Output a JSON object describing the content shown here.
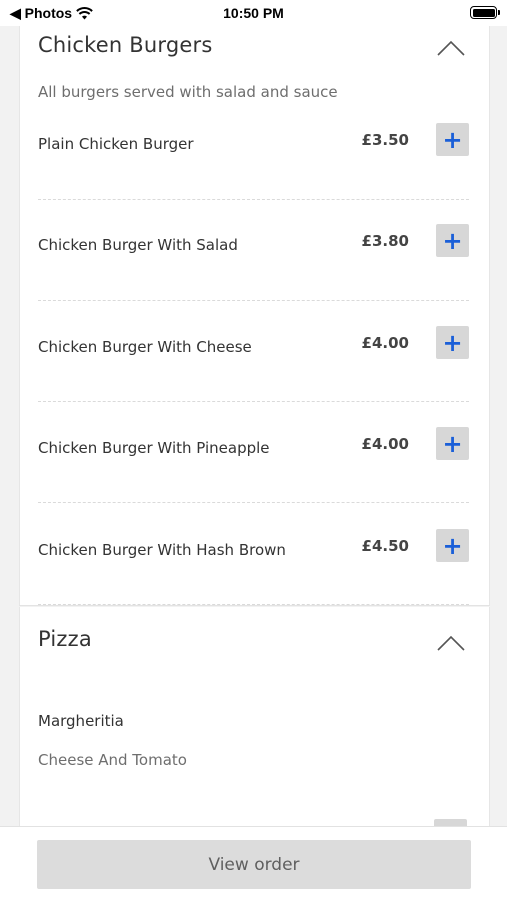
{
  "status_bar": {
    "back_label": "◀ Photos",
    "time": "10:50 PM"
  },
  "sections": [
    {
      "title": "Chicken Burgers",
      "description": "All burgers served with salad and sauce",
      "items": [
        {
          "name": "Plain Chicken Burger",
          "price": "£3.50"
        },
        {
          "name": "Chicken Burger With Salad",
          "price": "£3.80"
        },
        {
          "name": "Chicken Burger With Cheese",
          "price": "£4.00"
        },
        {
          "name": "Chicken Burger With Pineapple",
          "price": "£4.00"
        },
        {
          "name": "Chicken Burger With Hash Brown",
          "price": "£4.50"
        }
      ]
    },
    {
      "title": "Pizza",
      "items": [
        {
          "name": "Margheritia",
          "description": "Cheese And Tomato"
        }
      ]
    }
  ],
  "add_icon": "+",
  "view_order_label": "View order",
  "colors": {
    "accent": "#1a5fd8",
    "button_bg": "#d7d7d7"
  }
}
